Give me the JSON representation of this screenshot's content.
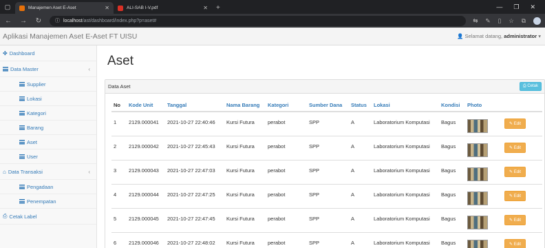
{
  "browser": {
    "tabs": [
      {
        "title": "Manajemen Aset E-Aset",
        "color": "#e8710a"
      },
      {
        "title": "ALI-SAB I-V.pdf",
        "color": "#d93025"
      }
    ],
    "url_host": "localhost",
    "url_path": "/ast/dashboard/index.php?p=aset#"
  },
  "app": {
    "brand": "Aplikasi Manajemen Aset E-Aset FT UISU",
    "greeting": "Selamat datang,",
    "username": "administrator",
    "user_caret": "▾"
  },
  "sidebar": {
    "items": [
      {
        "label": "Dashboard",
        "type": "top",
        "icon": "dashboard-icon"
      },
      {
        "label": "Data Master",
        "type": "top",
        "icon": "list-icon",
        "chevron": "‹"
      },
      {
        "label": "Supplier",
        "type": "sub",
        "icon": "table-icon"
      },
      {
        "label": "Lokasi",
        "type": "sub",
        "icon": "table-icon"
      },
      {
        "label": "Kategori",
        "type": "sub",
        "icon": "table-icon"
      },
      {
        "label": "Barang",
        "type": "sub",
        "icon": "table-icon"
      },
      {
        "label": "Aset",
        "type": "sub",
        "icon": "table-icon"
      },
      {
        "label": "User",
        "type": "sub",
        "icon": "table-icon"
      },
      {
        "label": "Data Transaksi",
        "type": "top",
        "icon": "bank-icon",
        "chevron": "‹"
      },
      {
        "label": "Pengadaan",
        "type": "sub",
        "icon": "table-icon"
      },
      {
        "label": "Penempatan",
        "type": "sub",
        "icon": "table-icon"
      },
      {
        "label": "Cetak Label",
        "type": "top",
        "icon": "print-icon"
      }
    ]
  },
  "main": {
    "title": "Aset",
    "panel_title": "Data Aset",
    "print_button": "Cetak",
    "columns": [
      "No",
      "Kode Unit",
      "Tanggal",
      "Nama Barang",
      "Kategori",
      "Sumber Dana",
      "Status",
      "Lokasi",
      "Kondisi",
      "Photo",
      ""
    ],
    "edit_label": "Edit",
    "rows": [
      {
        "no": "1",
        "kode": "2129.000041",
        "tanggal": "2021-10-27 22:40:46",
        "nama": "Kursi Futura",
        "kategori": "perabot",
        "sumber": "SPP",
        "status": "A",
        "lokasi": "Laboratorium Komputasi",
        "kondisi": "Bagus"
      },
      {
        "no": "2",
        "kode": "2129.000042",
        "tanggal": "2021-10-27 22:45:43",
        "nama": "Kursi Futura",
        "kategori": "perabot",
        "sumber": "SPP",
        "status": "A",
        "lokasi": "Laboratorium Komputasi",
        "kondisi": "Bagus"
      },
      {
        "no": "3",
        "kode": "2129.000043",
        "tanggal": "2021-10-27 22:47:03",
        "nama": "Kursi Futura",
        "kategori": "perabot",
        "sumber": "SPP",
        "status": "A",
        "lokasi": "Laboratorium Komputasi",
        "kondisi": "Bagus"
      },
      {
        "no": "4",
        "kode": "2129.000044",
        "tanggal": "2021-10-27 22:47:25",
        "nama": "Kursi Futura",
        "kategori": "perabot",
        "sumber": "SPP",
        "status": "A",
        "lokasi": "Laboratorium Komputasi",
        "kondisi": "Bagus"
      },
      {
        "no": "5",
        "kode": "2129.000045",
        "tanggal": "2021-10-27 22:47:45",
        "nama": "Kursi Futura",
        "kategori": "perabot",
        "sumber": "SPP",
        "status": "A",
        "lokasi": "Laboratorium Komputasi",
        "kondisi": "Bagus"
      },
      {
        "no": "6",
        "kode": "2129.000046",
        "tanggal": "2021-10-27 22:48:02",
        "nama": "Kursi Futura",
        "kategori": "perabot",
        "sumber": "SPP",
        "status": "A",
        "lokasi": "Laboratorium Komputasi",
        "kondisi": "Bagus"
      }
    ]
  },
  "colors": {
    "link": "#337ab7",
    "edit": "#f0ad4e",
    "print": "#5bc0de"
  }
}
